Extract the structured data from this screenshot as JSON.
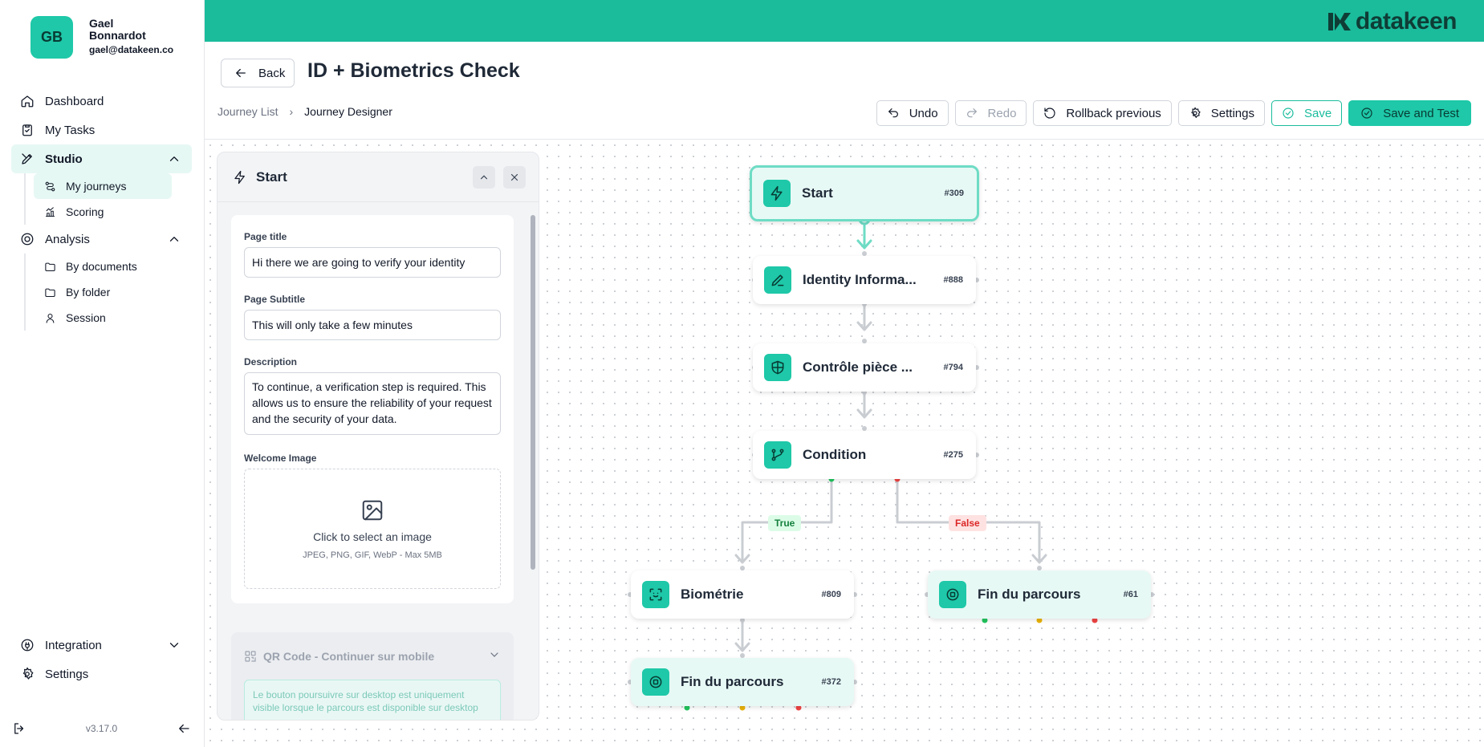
{
  "user": {
    "initials": "GB",
    "name": "Gael Bonnardot",
    "email": "gael@datakeen.co"
  },
  "nav": {
    "dashboard": "Dashboard",
    "my_tasks": "My Tasks",
    "studio": "Studio",
    "my_journeys": "My journeys",
    "scoring": "Scoring",
    "analysis": "Analysis",
    "by_documents": "By documents",
    "by_folder": "By folder",
    "session": "Session",
    "integration": "Integration",
    "settings": "Settings",
    "version": "v3.17.0"
  },
  "brand": {
    "logo_text": "datakeen",
    "accent": "#1abc9c"
  },
  "header": {
    "back_label": "Back",
    "title": "ID + Biometrics Check"
  },
  "breadcrumb": {
    "item1": "Journey List",
    "item2": "Journey Designer"
  },
  "toolbar": {
    "undo": "Undo",
    "redo": "Redo",
    "rollback": "Rollback previous",
    "settings": "Settings",
    "save": "Save",
    "save_test": "Save and Test"
  },
  "panel": {
    "title": "Start",
    "page_title_label": "Page title",
    "page_title_value": "Hi there we are going to verify your identity",
    "page_subtitle_label": "Page Subtitle",
    "page_subtitle_value": "This will only take a few minutes",
    "description_label": "Description",
    "description_value": "To continue, a verification step is required. This allows us to ensure the reliability of your request and the security of your data.",
    "welcome_image_label": "Welcome Image",
    "upload_main": "Click to select an image",
    "upload_sub": "JPEG, PNG, GIF, WebP - Max 5MB",
    "qr_title": "QR Code - Continuer sur mobile",
    "qr_note": "Le bouton poursuivre sur desktop est uniquement visible lorsque le parcours est disponible sur desktop"
  },
  "nodes": {
    "start": {
      "label": "Start",
      "id": "#309",
      "icon": "lightning-icon"
    },
    "identity": {
      "label": "Identity Informa...",
      "id": "#888",
      "icon": "pencil-icon"
    },
    "controle": {
      "label": "Contrôle pièce ...",
      "id": "#794",
      "icon": "shield-icon"
    },
    "condition": {
      "label": "Condition",
      "id": "#275",
      "icon": "branch-icon"
    },
    "biometrie": {
      "label": "Biométrie",
      "id": "#809",
      "icon": "face-icon"
    },
    "fin_right": {
      "label": "Fin du parcours",
      "id": "#61",
      "icon": "stop-icon"
    },
    "fin_bottom": {
      "label": "Fin du parcours",
      "id": "#372",
      "icon": "stop-icon"
    }
  },
  "edges": {
    "true_label": "True",
    "false_label": "False"
  }
}
